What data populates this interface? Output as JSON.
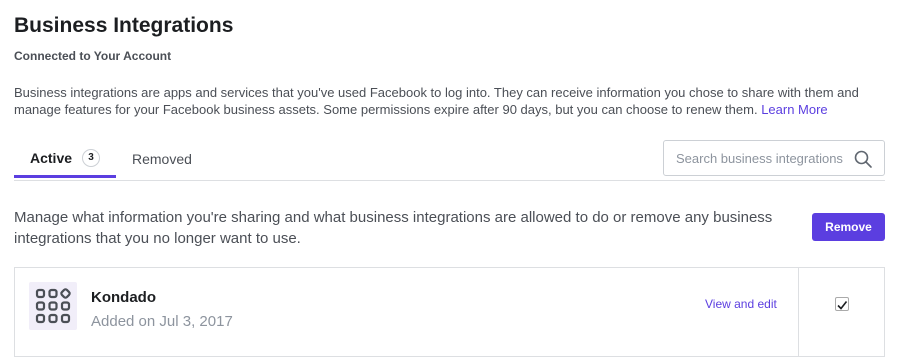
{
  "header": {
    "title": "Business Integrations",
    "subtitle": "Connected to Your Account",
    "description": "Business integrations are apps and services that you've used Facebook to log into. They can receive information you chose to share with them and manage features for your Facebook business assets. Some permissions expire after 90 days, but you can choose to renew them.",
    "learn_more": "Learn More"
  },
  "tabs": [
    {
      "label": "Active",
      "count": "3",
      "active": true
    },
    {
      "label": "Removed",
      "active": false
    }
  ],
  "search": {
    "placeholder": "Search business integrations",
    "value": ""
  },
  "manage": {
    "text": "Manage what information you're sharing and what business integrations are allowed to do or remove any business integrations that you no longer want to use.",
    "remove_label": "Remove"
  },
  "integrations": [
    {
      "name": "Kondado",
      "added": "Added on Jul 3, 2017",
      "action": "View and edit",
      "checked": true
    }
  ],
  "colors": {
    "accent": "#5b3ee0",
    "text": "#1c1e21",
    "muted": "#4b4f56"
  }
}
